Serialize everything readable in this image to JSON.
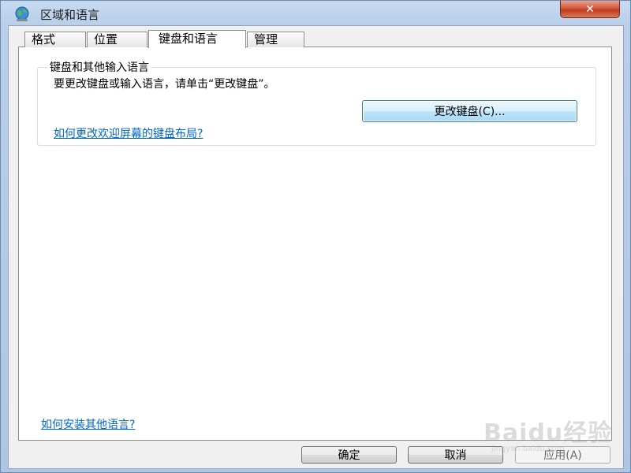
{
  "window": {
    "title": "区域和语言",
    "close_label": "✕"
  },
  "tabs": [
    {
      "label": "格式"
    },
    {
      "label": "位置"
    },
    {
      "label": "键盘和语言"
    },
    {
      "label": "管理"
    }
  ],
  "active_tab": 2,
  "keyboard_group": {
    "title": "键盘和其他输入语言",
    "description": "要更改键盘或输入语言，请单击“更改键盘”。",
    "change_button": "更改键盘(C)...",
    "welcome_link": "如何更改欢迎屏幕的键盘布局?"
  },
  "install_link": "如何安装其他语言?",
  "buttons": {
    "ok": "确定",
    "cancel": "取消",
    "apply": "应用(A)"
  },
  "watermark": {
    "text": "Baidu经验",
    "sub": "jingyan.baidu.com"
  },
  "colors": {
    "link": "#0066cc",
    "close_button": "#c9472b",
    "title_bar": "#b9cfe9"
  }
}
